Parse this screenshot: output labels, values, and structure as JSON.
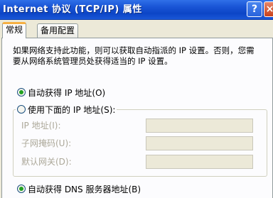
{
  "window": {
    "title": "Internet 协议 (TCP/IP) 属性",
    "help_glyph": "?",
    "close_glyph": "×"
  },
  "tabs": [
    {
      "label": "常规"
    },
    {
      "label": "备用配置"
    }
  ],
  "general": {
    "description": "如果网络支持此功能，则可以获取自动指派的 IP 设置。否则，您需要从网络系统管理员处获得适当的 IP 设置。",
    "auto_ip_label": "自动获得 IP 地址(O)",
    "manual_ip_label": "使用下面的 IP 地址(S):",
    "ip_address_label": "IP 地址(I):",
    "subnet_mask_label": "子网掩码(U):",
    "gateway_label": "默认网关(D):",
    "auto_dns_label": "自动获得 DNS 服务器地址(B)",
    "auto_ip_selected": true,
    "auto_dns_selected": true
  }
}
